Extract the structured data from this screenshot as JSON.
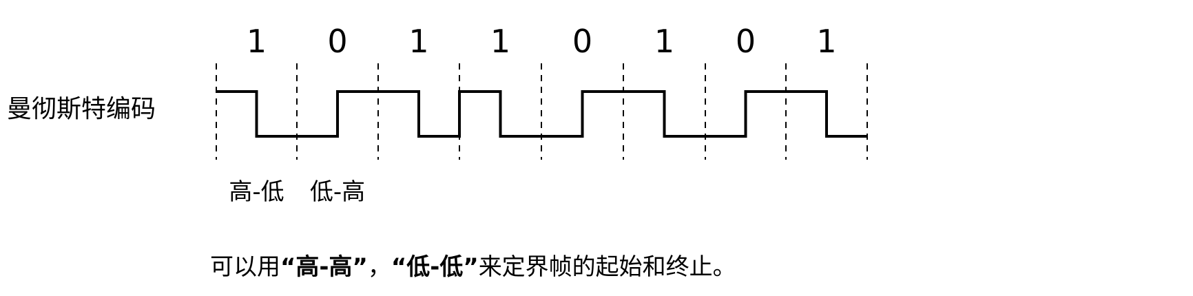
{
  "row_label": "曼彻斯特编码",
  "bits": [
    "1",
    "0",
    "1",
    "1",
    "0",
    "1",
    "0",
    "1"
  ],
  "transition_labels": [
    "高-低",
    "低-高"
  ],
  "note": {
    "prefix": "可以用",
    "open_quote_1": "“",
    "term_1": "高-高",
    "close_quote_1": "”",
    "separator": "，",
    "open_quote_2": "“",
    "term_2": "低-低",
    "close_quote_2": "”",
    "suffix": "来定界帧的起始和终止。"
  }
}
